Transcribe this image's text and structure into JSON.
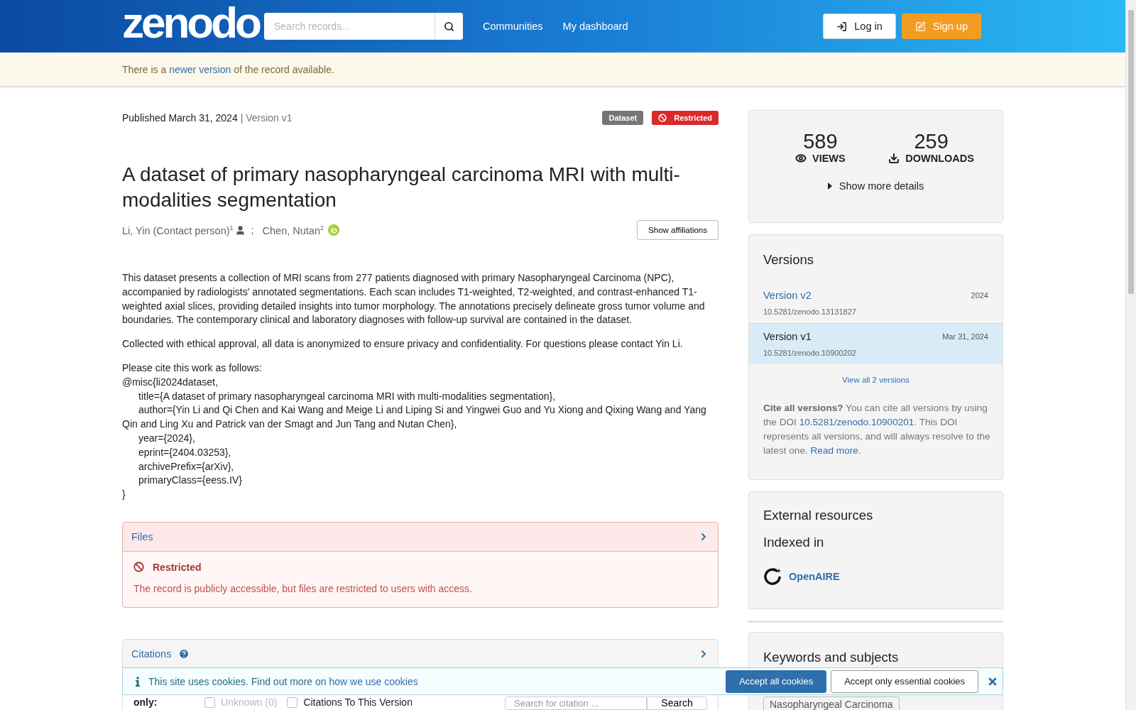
{
  "header": {
    "logo": "zenodo",
    "search": {
      "placeholder": "Search records..."
    },
    "nav": [
      "Communities",
      "My dashboard"
    ],
    "login": "Log in",
    "signup": "Sign up"
  },
  "notice": {
    "before": "There is a ",
    "link": "newer version",
    "after": " of the record available."
  },
  "record": {
    "published": "Published March 31, 2024",
    "version": "| Version v1",
    "badges": [
      {
        "label": "Dataset",
        "kind": "type"
      },
      {
        "label": "Restricted",
        "kind": "access"
      }
    ],
    "title": "A dataset of primary nasopharyngeal carcinoma MRI with multi-modalities segmentation",
    "creators": [
      {
        "name": "Li, Yin (Contact person)",
        "affiliation": "1",
        "kind": "contact"
      },
      {
        "name": "Chen, Nutan",
        "affiliation": "2",
        "kind": "orcid"
      }
    ],
    "separator": ";",
    "show_affiliations": "Show affiliations",
    "description": [
      "This dataset presents a collection of MRI scans from 277 patients diagnosed with primary Nasopharyngeal Carcinoma (NPC), accompanied by radiologists' annotated segmentations. Each scan includes T1-weighted, T2-weighted, and contrast-enhanced T1-weighted axial slices, providing detailed insights into tumor morphology. The annotations precisely delineate gross tumor volume and boundaries. The contemporary clinical and laboratory diagnoses with follow-up survival are contained in the dataset.",
      "Collected with ethical approval, all data is anonymized to ensure privacy and confidentiality. For questions please contact Yin Li."
    ],
    "citation": [
      {
        "text": "Please cite this work as follows:",
        "indented": false
      },
      {
        "text": "@misc{li2024dataset,",
        "indented": false
      },
      {
        "text": "title={A dataset of primary nasopharyngeal carcinoma MRI with multi-modalities segmentation},",
        "indented": true
      },
      {
        "text": "author={Yin Li and Qi Chen and Kai Wang and Meige Li and Liping Si and Yingwei Guo and Yu Xiong and Qixing Wang and Yang Qin and Ling Xu and Patrick van der Smagt and Jun Tang and Nutan Chen},",
        "indented": true
      },
      {
        "text": "year={2024},",
        "indented": true
      },
      {
        "text": "eprint={2404.03253},",
        "indented": true
      },
      {
        "text": "archivePrefix={arXiv},",
        "indented": true
      },
      {
        "text": "primaryClass={eess.IV}",
        "indented": true
      },
      {
        "text": "}",
        "indented": false
      }
    ]
  },
  "files": {
    "title": "Files",
    "status": "Restricted",
    "message": "The record is publicly accessible, but files are restricted to users with access."
  },
  "citations": {
    "title": "Citations",
    "filter_label": "only:",
    "filters": [
      {
        "label": "Unknown (0)",
        "checked": false,
        "disabled": true
      },
      {
        "label": "Citations To This Version",
        "checked": false,
        "disabled": false
      }
    ],
    "search_placeholder": "Search for citation ...",
    "search_button": "Search"
  },
  "sidebar": {
    "stats": [
      {
        "value": "589",
        "label": "VIEWS",
        "kind": "views"
      },
      {
        "value": "259",
        "label": "DOWNLOADS",
        "kind": "downloads"
      }
    ],
    "more": "Show more details",
    "versions": {
      "title": "Versions",
      "items": [
        {
          "label": "Version v2",
          "date": "2024",
          "doi": "10.5281/zenodo.13131827",
          "selected": false
        },
        {
          "label": "Version v1",
          "date": "Mar 31, 2024",
          "doi": "10.5281/zenodo.10900202",
          "selected": true
        }
      ],
      "view_all": "View all 2 versions",
      "cite": {
        "lead": "Cite all versions?",
        "text1": " You can cite all versions by using the DOI ",
        "doi": "10.5281/zenodo.10900201",
        "text2": ". This DOI represents all versions, and will always resolve to the latest one. ",
        "link": "Read more",
        "end": "."
      }
    },
    "external": {
      "title": "External resources",
      "subtitle": "Indexed in",
      "items": [
        {
          "name": "OpenAIRE"
        }
      ]
    },
    "keywords": {
      "title": "Keywords and subjects",
      "tags": [
        "Nasopharyngeal Carcinoma"
      ]
    }
  },
  "cookie": {
    "text": "This site uses cookies. Find out more on ",
    "link": "how we use cookies",
    "accept_all": "Accept all cookies",
    "accept_essential": "Accept only essential cookies"
  }
}
